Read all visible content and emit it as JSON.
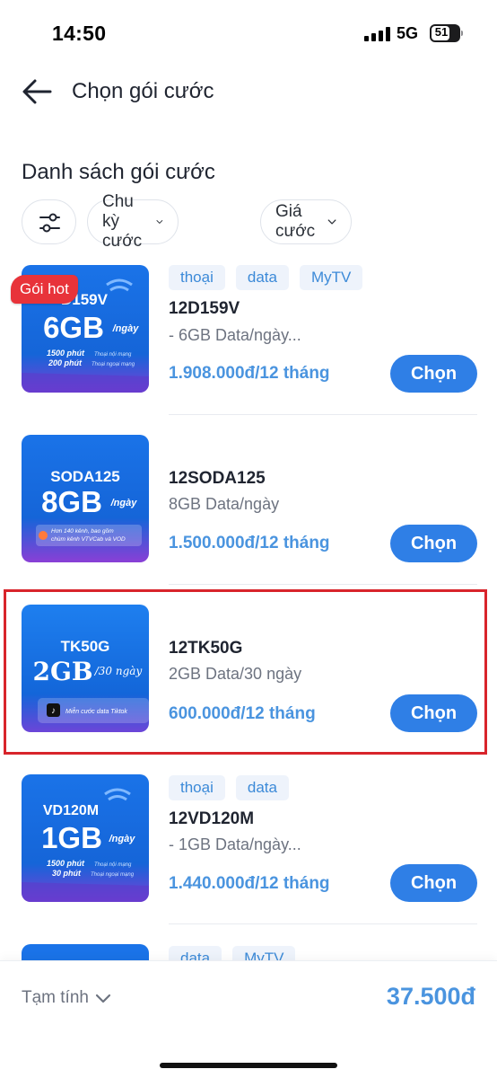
{
  "status_bar": {
    "time": "14:50",
    "network": "5G",
    "battery": "51"
  },
  "header": {
    "title": "Chọn gói cước"
  },
  "section": {
    "title": "Danh sách gói cước"
  },
  "filters": {
    "cycle": "Chu kỳ cước",
    "price": "Giá cước"
  },
  "packages": [
    {
      "tags": [
        "thoại",
        "data",
        "MyTV"
      ],
      "name": "12D159V",
      "desc": "- 6GB Data/ngày...",
      "price": "1.908.000đ/12 tháng",
      "button": "Chọn",
      "badge": "Gói hot",
      "thumb": {
        "code": "D159V",
        "big": "6GB",
        "unit": "/ngày",
        "line1": "1500 phút",
        "line1b": "Thoại nội mạng",
        "line2": "200 phút",
        "line2b": "Thoại ngoại mạng"
      }
    },
    {
      "tags": [],
      "name": "12SODA125",
      "desc": "8GB Data/ngày",
      "price": "1.500.000đ/12 tháng",
      "button": "Chọn",
      "thumb": {
        "code": "SODA125",
        "big": "8GB",
        "unit": "/ngày",
        "note": "Hơn 140 kênh, bao gồm",
        "note2": "chùm kênh VTVCab và VOD"
      }
    },
    {
      "tags": [],
      "name": "12TK50G",
      "desc": "2GB Data/30 ngày",
      "price": "600.000đ/12 tháng",
      "button": "Chọn",
      "thumb": {
        "code": "TK50G",
        "big": "2GB",
        "unit": "/30 ngày",
        "note": "Miễn cước data Tiktok"
      }
    },
    {
      "tags": [
        "thoại",
        "data"
      ],
      "name": "12VD120M",
      "desc": "- 1GB Data/ngày...",
      "price": "1.440.000đ/12 tháng",
      "button": "Chọn",
      "thumb": {
        "code": "VD120M",
        "big": "1GB",
        "unit": "/ngày",
        "line1": "1500 phút",
        "line1b": "Thoại nội mạng",
        "line2": "30 phút",
        "line2b": "Thoại ngoại mạng"
      }
    },
    {
      "tags": [
        "data",
        "MyTV"
      ]
    }
  ],
  "bottom": {
    "subtotal_label": "Tạm tính",
    "total": "37.500đ"
  },
  "colors": {
    "accent": "#2f7fe6",
    "price": "#4a94df",
    "tag_bg": "#eef3fb",
    "hot": "#e8333a",
    "highlight": "#d8242b"
  }
}
